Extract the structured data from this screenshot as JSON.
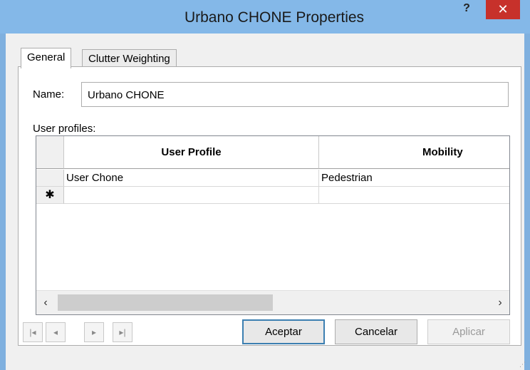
{
  "window": {
    "title": "Urbano CHONE Properties",
    "help_label": "?",
    "close_label": "✕"
  },
  "tabs": [
    {
      "label": "General",
      "active": true
    },
    {
      "label": "Clutter Weighting",
      "active": false
    }
  ],
  "form": {
    "name_label": "Name:",
    "name_value": "Urbano CHONE",
    "profiles_label": "User profiles:"
  },
  "grid": {
    "columns": [
      "User Profile",
      "Mobility"
    ],
    "rows": [
      {
        "marker": "",
        "cells": [
          "User Chone",
          "Pedestrian"
        ]
      },
      {
        "marker": "✱",
        "cells": [
          "",
          ""
        ]
      }
    ],
    "scroll_left": "‹",
    "scroll_right": "›"
  },
  "nav": {
    "first": "|◂",
    "prev": "◂",
    "next": "▸",
    "last": "▸|"
  },
  "buttons": {
    "ok": "Aceptar",
    "cancel": "Cancelar",
    "apply": "Aplicar"
  },
  "colors": {
    "title_bar": "#84b8e8",
    "close": "#c7312b",
    "default_button_border": "#3c7fb1"
  }
}
